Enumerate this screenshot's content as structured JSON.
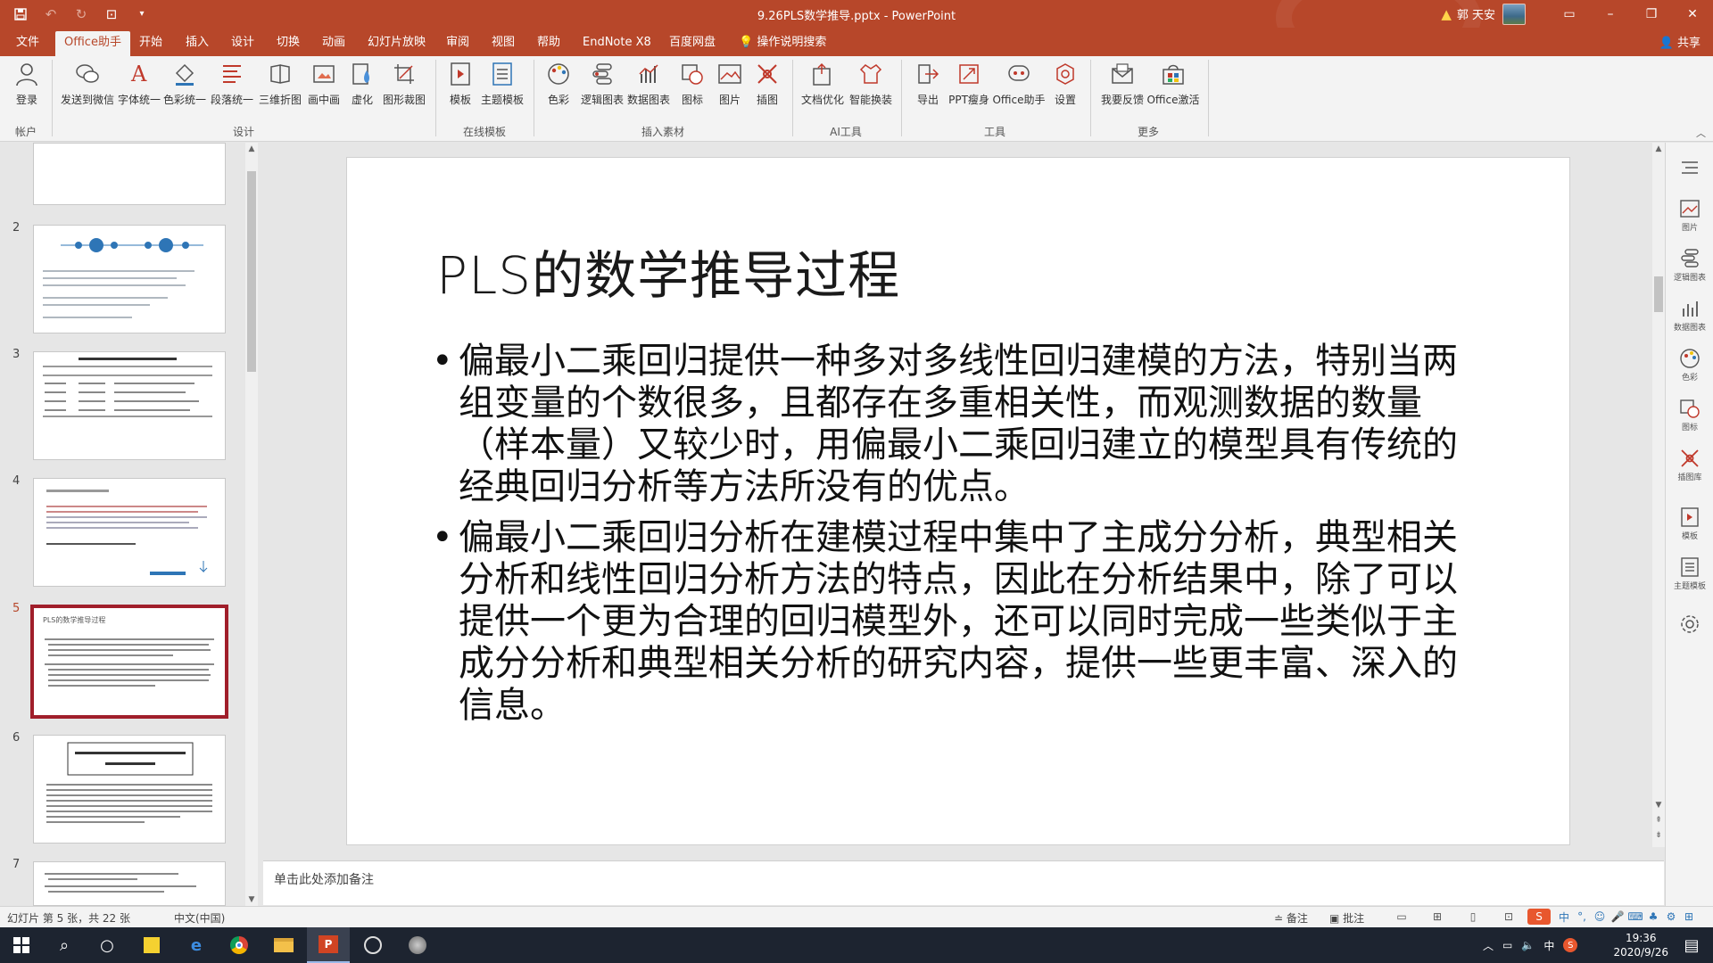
{
  "window": {
    "title": "9.26PLS数学推导.pptx  -  PowerPoint",
    "user": "郭 天安",
    "warning_icon": "warning-icon"
  },
  "ribbon_tabs": [
    "文件",
    "Office助手",
    "开始",
    "插入",
    "设计",
    "切换",
    "动画",
    "幻灯片放映",
    "审阅",
    "视图",
    "帮助",
    "EndNote X8",
    "百度网盘",
    "操作说明搜索"
  ],
  "share_label": "共享",
  "ribbon": {
    "buttons": [
      {
        "label": "登录",
        "icon": "user-icon"
      },
      {
        "label": "发送到微信",
        "icon": "wechat-icon"
      },
      {
        "label": "字体统一",
        "icon": "font-icon"
      },
      {
        "label": "色彩统一",
        "icon": "fill-icon"
      },
      {
        "label": "段落统一",
        "icon": "paragraph-icon"
      },
      {
        "label": "三维折图",
        "icon": "fold-icon"
      },
      {
        "label": "画中画",
        "icon": "pip-icon"
      },
      {
        "label": "虚化",
        "icon": "blur-icon"
      },
      {
        "label": "图形裁图",
        "icon": "crop-icon"
      },
      {
        "label": "模板",
        "icon": "template-icon"
      },
      {
        "label": "主题模板",
        "icon": "theme-icon"
      },
      {
        "label": "色彩",
        "icon": "palette-icon"
      },
      {
        "label": "逻辑图表",
        "icon": "logic-chart-icon"
      },
      {
        "label": "数据图表",
        "icon": "data-chart-icon"
      },
      {
        "label": "图标",
        "icon": "icons-icon"
      },
      {
        "label": "图片",
        "icon": "image-icon"
      },
      {
        "label": "插图",
        "icon": "illustration-icon"
      },
      {
        "label": "文档优化",
        "icon": "doc-optimize-icon"
      },
      {
        "label": "智能换装",
        "icon": "smart-dress-icon"
      },
      {
        "label": "导出",
        "icon": "export-icon"
      },
      {
        "label": "PPT瘦身",
        "icon": "slim-icon"
      },
      {
        "label": "Office助手",
        "icon": "assistant-icon"
      },
      {
        "label": "设置",
        "icon": "settings-icon"
      },
      {
        "label": "我要反馈",
        "icon": "feedback-icon"
      },
      {
        "label": "Office激活",
        "icon": "activate-icon"
      }
    ],
    "groups": [
      "帐户",
      "设计",
      "在线模板",
      "插入素材",
      "AI工具",
      "工具",
      "更多"
    ]
  },
  "thumbnails": [
    {
      "number": "",
      "title": ""
    },
    {
      "number": "2",
      "title": ""
    },
    {
      "number": "3",
      "title": ""
    },
    {
      "number": "4",
      "title": ""
    },
    {
      "number": "5",
      "title": "PLS的数学推导过程"
    },
    {
      "number": "6",
      "title": ""
    },
    {
      "number": "7",
      "title": ""
    }
  ],
  "slide": {
    "title": "PLS的数学推导过程",
    "bullets": [
      "偏最小二乘回归提供一种多对多线性回归建模的方法，特别当两组变量的个数很多，且都存在多重相关性，而观测数据的数量（样本量）又较少时，用偏最小二乘回归建立的模型具有传统的经典回归分析等方法所没有的优点。",
      "偏最小二乘回归分析在建模过程中集中了主成分分析，典型相关分析和线性回归分析方法的特点，因此在分析结果中，除了可以提供一个更为合理的回归模型外，还可以同时完成一些类似于主成分分析和典型相关分析的研究内容，提供一些更丰富、深入的信息。"
    ]
  },
  "notes_placeholder": "单击此处添加备注",
  "side_pane": [
    {
      "label": "",
      "icon": "menu-icon"
    },
    {
      "label": "图片",
      "icon": "image-icon"
    },
    {
      "label": "逻辑图表",
      "icon": "logic-chart-icon"
    },
    {
      "label": "数据图表",
      "icon": "data-chart-icon"
    },
    {
      "label": "色彩",
      "icon": "palette-icon"
    },
    {
      "label": "图标",
      "icon": "icons-icon"
    },
    {
      "label": "插图库",
      "icon": "illustration-icon"
    },
    {
      "label": "模板",
      "icon": "template-icon"
    },
    {
      "label": "主题模板",
      "icon": "theme-icon"
    },
    {
      "label": "",
      "icon": "settings-icon"
    }
  ],
  "status": {
    "slide_info": "幻灯片 第 5 张，共 22 张",
    "language": "中文(中国)",
    "notes_btn": "备注",
    "comments_btn": "批注"
  },
  "taskbar": {
    "time": "19:36",
    "date": "2020/9/26",
    "ime": "中"
  },
  "colors": {
    "accent": "#b7472a",
    "selected_thumb": "#a01e2a",
    "taskbar": "#1d2430"
  }
}
